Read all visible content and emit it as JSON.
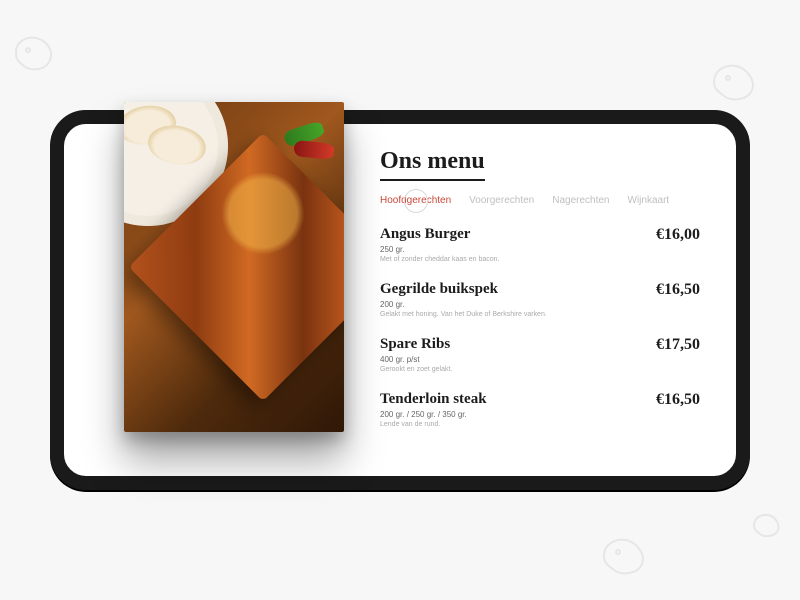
{
  "title": "Ons menu",
  "tabs": [
    {
      "label": "Hoofdgerechten",
      "active": true
    },
    {
      "label": "Voorgerechten",
      "active": false
    },
    {
      "label": "Nagerechten",
      "active": false
    },
    {
      "label": "Wijnkaart",
      "active": false
    }
  ],
  "items": [
    {
      "name": "Angus Burger",
      "weight": "250 gr.",
      "description": "Met of zonder cheddar kaas en bacon.",
      "price": "€16,00"
    },
    {
      "name": "Gegrilde buikspek",
      "weight": "200 gr.",
      "description": "Gelakt met honing. Van het Duke of Berkshire varken.",
      "price": "€16,50"
    },
    {
      "name": "Spare Ribs",
      "weight": "400 gr. p/st",
      "description": "Gerookt en zoet gelakt.",
      "price": "€17,50"
    },
    {
      "name": "Tenderloin steak",
      "weight": "200 gr. / 250 gr. / 350 gr.",
      "description": "Lende van de rund.",
      "price": "€16,50"
    }
  ]
}
